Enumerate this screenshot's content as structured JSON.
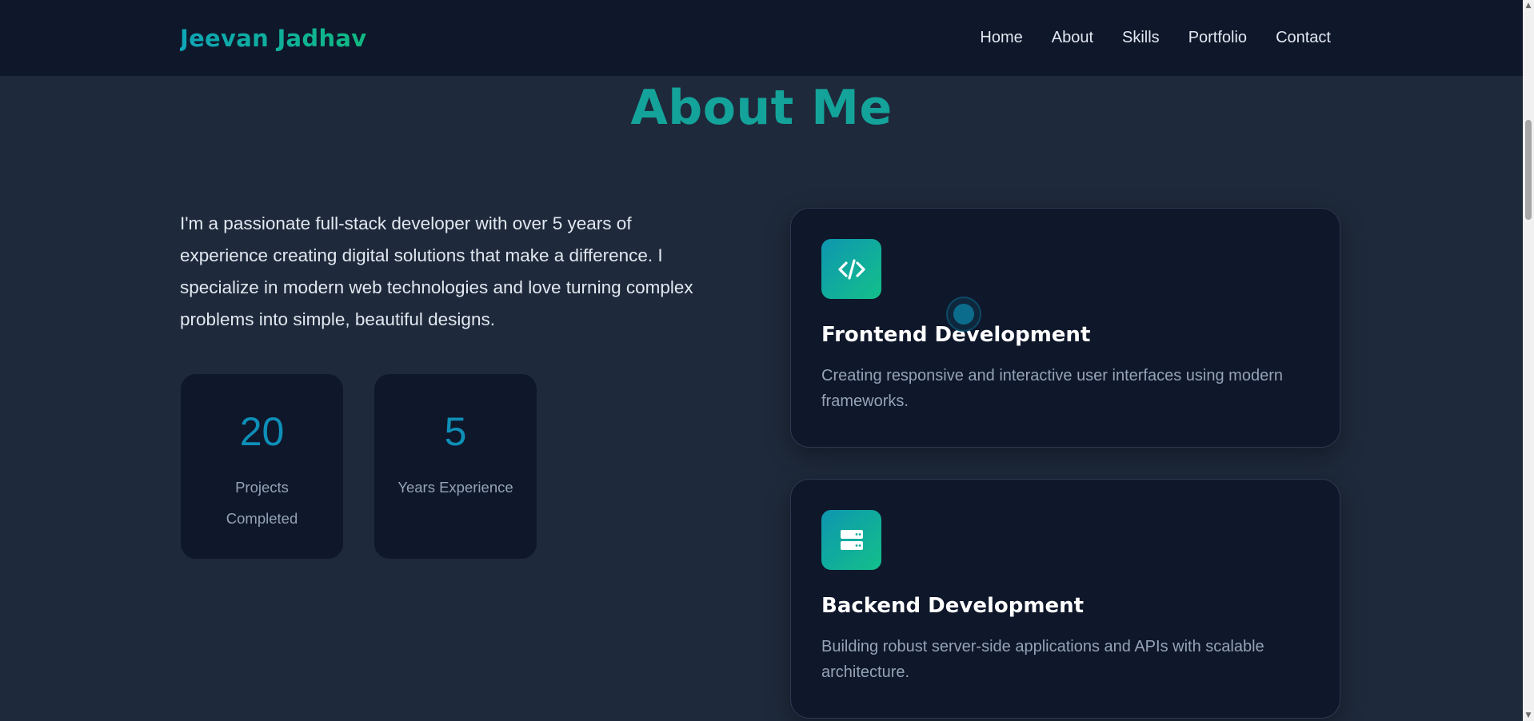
{
  "header": {
    "brand": "Jeevan Jadhav",
    "nav": [
      {
        "label": "Home"
      },
      {
        "label": "About"
      },
      {
        "label": "Skills"
      },
      {
        "label": "Portfolio"
      },
      {
        "label": "Contact"
      }
    ]
  },
  "about": {
    "title": "About Me",
    "paragraph": "I'm a passionate full-stack developer with over 5 years of experience creating digital solutions that make a difference. I specialize in modern web technologies and love turning complex problems into simple, beautiful designs.",
    "stats": [
      {
        "number": "20",
        "label": "Projects Completed"
      },
      {
        "number": "5",
        "label": "Years Experience"
      }
    ],
    "services": [
      {
        "icon": "code-icon",
        "title": "Frontend Development",
        "description": "Creating responsive and interactive user interfaces using modern frameworks."
      },
      {
        "icon": "server-icon",
        "title": "Backend Development",
        "description": "Building robust server-side applications and APIs with scalable architecture."
      }
    ]
  },
  "colors": {
    "page_bg": "#1e293b",
    "header_bg": "#0f172a",
    "accent": "#14a39a",
    "stat_number": "#0e8fb8",
    "muted_text": "#94a3b8"
  }
}
